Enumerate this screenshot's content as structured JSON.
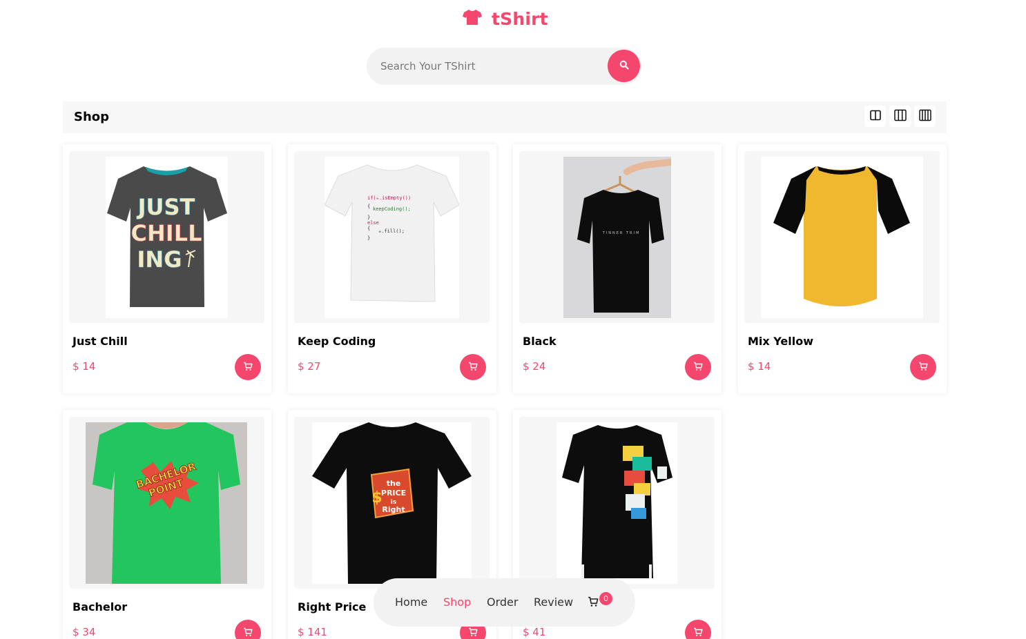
{
  "brand": {
    "name": "tShirt",
    "icon": "tshirt-icon",
    "color": "#f5476d"
  },
  "search": {
    "placeholder": "Search Your TShirt",
    "value": "",
    "icon": "search-icon"
  },
  "shop": {
    "title": "Shop",
    "layout_options": [
      "two-column-layout-icon",
      "three-column-layout-icon",
      "four-column-layout-icon"
    ]
  },
  "currency": "$",
  "products": [
    {
      "name": "Just Chill",
      "price": "$ 14",
      "image_desc": "JUST CHILL ING",
      "color": "#4a4a4a"
    },
    {
      "name": "Keep Coding",
      "price": "$ 27",
      "image_desc": "code print",
      "color": "#f0f0f0"
    },
    {
      "name": "Black",
      "price": "$ 24",
      "image_desc": "black tee on hanger",
      "color": "#111111"
    },
    {
      "name": "Mix Yellow",
      "price": "$ 14",
      "image_desc": "yellow raglan",
      "color": "#f0b82e"
    },
    {
      "name": "Bachelor",
      "price": "$ 34",
      "image_desc": "BACHELOR POINT",
      "color": "#22c55e"
    },
    {
      "name": "Right Price",
      "price": "$ 141",
      "image_desc": "the Price is Right",
      "color": "#111111"
    },
    {
      "name": "",
      "price": "$ 41",
      "image_desc": "graphic tee",
      "color": "#111111"
    }
  ],
  "nav": {
    "items": [
      {
        "label": "Home",
        "active": false
      },
      {
        "label": "Shop",
        "active": true
      },
      {
        "label": "Order",
        "active": false
      },
      {
        "label": "Review",
        "active": false
      }
    ],
    "cart_count": "0"
  },
  "colors": {
    "accent": "#f5476d",
    "panel": "#f7f7f7"
  }
}
